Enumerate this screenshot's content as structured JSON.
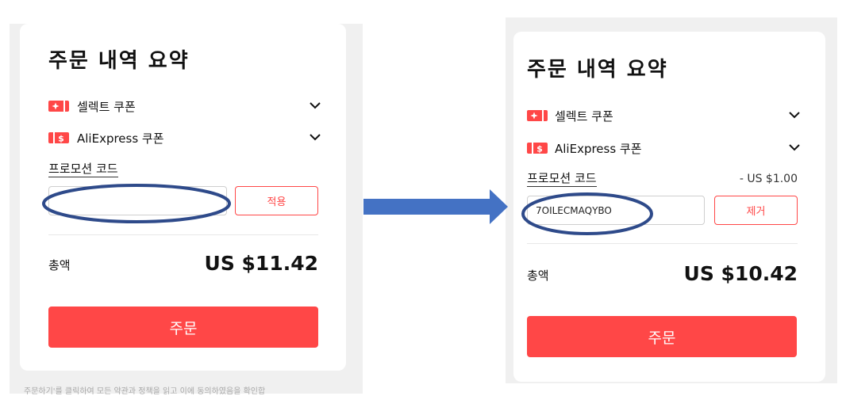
{
  "colors": {
    "accent": "#ff4747",
    "annotation": "#2e4a8a",
    "arrow": "#4472c4"
  },
  "before": {
    "title": "주문 내역 요약",
    "coupons": [
      {
        "icon": "select-coupon-icon",
        "label": "셀렉트 쿠폰"
      },
      {
        "icon": "aliexpress-coupon-icon",
        "label": "AliExpress 쿠폰"
      }
    ],
    "promo": {
      "label": "프로모션 코드",
      "input_value": "",
      "button_label": "적용"
    },
    "total": {
      "label": "총액",
      "value": "US $11.42"
    },
    "order_button": "주문",
    "footnote": "주문하기'를 클릭하여 모든 약관과 정책을 읽고 이에 동의하였음을 확인합"
  },
  "after": {
    "title": "주문 내역 요약",
    "coupons": [
      {
        "icon": "select-coupon-icon",
        "label": "셀렉트 쿠폰"
      },
      {
        "icon": "aliexpress-coupon-icon",
        "label": "AliExpress 쿠폰"
      }
    ],
    "promo": {
      "label": "프로모션 코드",
      "discount": "- US $1.00",
      "input_value": "7OILECMAQYBO",
      "button_label": "제거"
    },
    "total": {
      "label": "총액",
      "value": "US $10.42"
    },
    "order_button": "주문"
  }
}
